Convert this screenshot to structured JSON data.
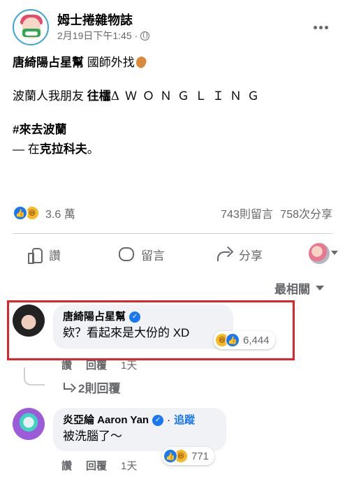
{
  "post": {
    "page_name": "姆士捲雜物誌",
    "timestamp": "2月19日下午1:45",
    "meta_sep": "·",
    "line1_bold": "唐綺陽占星幫",
    "line1_rest": " 國師外找",
    "line2_text": "波蘭人我朋友 ",
    "line2_bold": "往櫺",
    "line2_spaced": "ΔＷＯＮＧＬＩＮＧ",
    "hashtag": "#來去波蘭",
    "location_prefix": "— 在",
    "location_bold": "克拉科夫",
    "location_suffix": "。"
  },
  "stats": {
    "reactions": "3.6 萬",
    "comments": "743則留言",
    "shares": "758次分享"
  },
  "actions": {
    "like": "讚",
    "comment": "留言",
    "share": "分享"
  },
  "sort": {
    "label": "最相關"
  },
  "comments": [
    {
      "name": "唐綺陽占星幫",
      "text": "欸？看起來是大份的 XD",
      "reaction_count": "6,444",
      "like_label": "讚",
      "reply_label": "回覆",
      "time": "1天",
      "replies_label": "2則回覆"
    },
    {
      "name": "炎亞綸 Aaron Yan",
      "follow": "追蹤",
      "text": "被洗腦了～",
      "reaction_count": "771",
      "like_label": "讚",
      "reply_label": "回覆",
      "time": "1天"
    }
  ],
  "colors": {
    "accent": "#1877f2",
    "highlight": "#e0242b",
    "muted": "#65676b"
  }
}
